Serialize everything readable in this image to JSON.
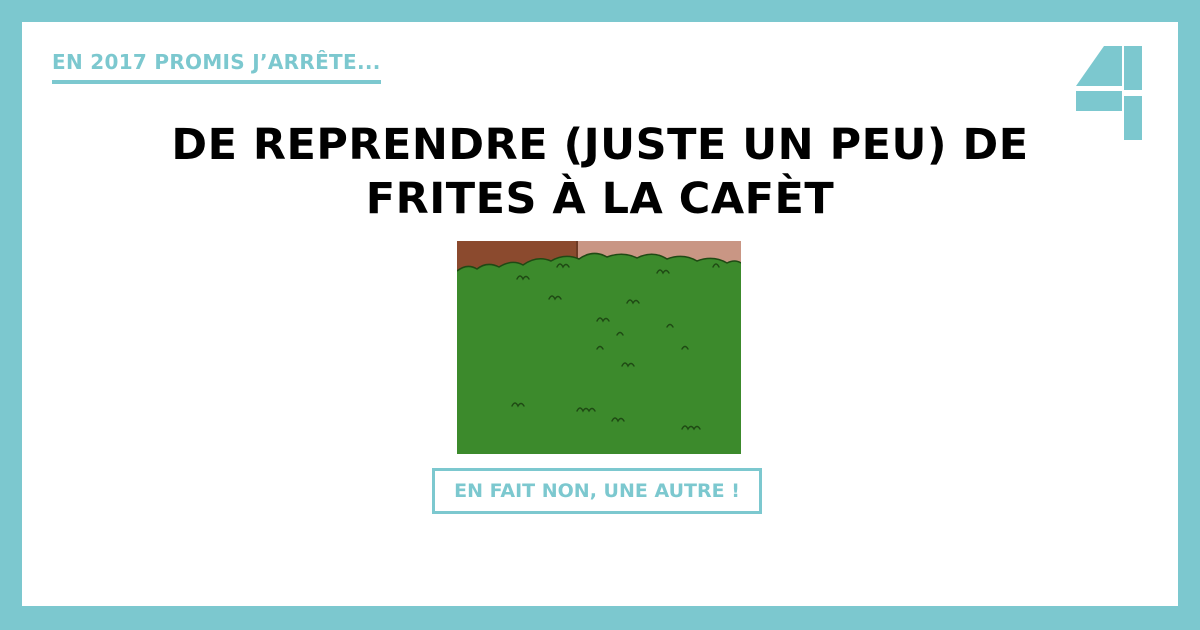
{
  "kicker": "EN 2017 PROMIS J’ARRÊTE...",
  "headline": {
    "line1": "DE REPRENDRE (JUSTE UN PEU) DE",
    "line2": "FRITES À LA CAFÈT"
  },
  "cta": {
    "label": "EN FAIT NON, UNE AUTRE !"
  },
  "colors": {
    "frame": "#7cc8cf",
    "accent": "#7cc8cf",
    "text": "#000000",
    "background": "#ffffff"
  },
  "icons": {
    "logo": "channel-4-logo",
    "image": "green-bush-illustration"
  }
}
